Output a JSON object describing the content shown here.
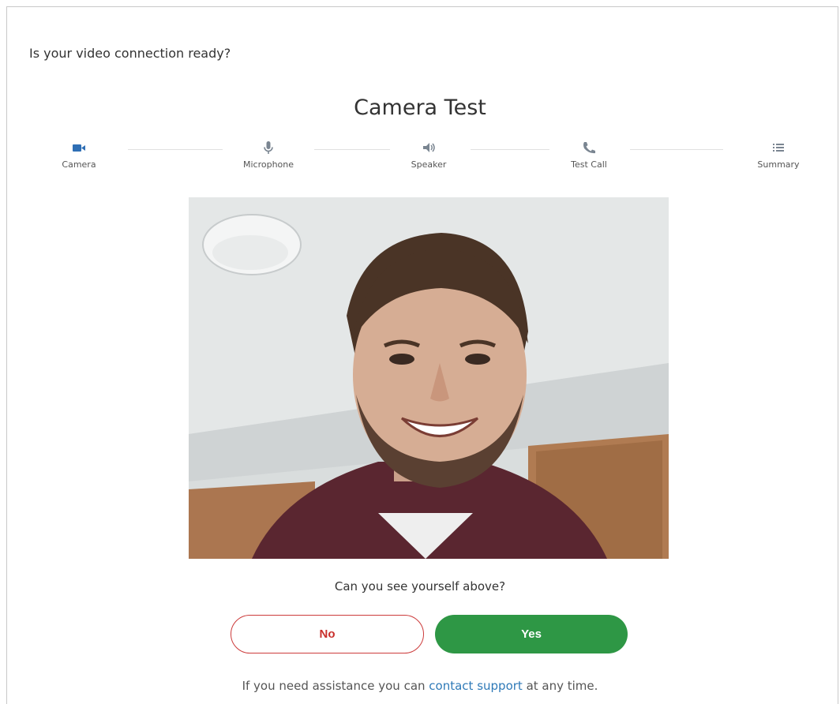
{
  "header": {
    "question": "Is your video connection ready?"
  },
  "page": {
    "title": "Camera Test"
  },
  "steps": [
    {
      "label": "Camera",
      "icon": "camera-icon",
      "active": true
    },
    {
      "label": "Microphone",
      "icon": "microphone-icon",
      "active": false
    },
    {
      "label": "Speaker",
      "icon": "speaker-icon",
      "active": false
    },
    {
      "label": "Test Call",
      "icon": "phone-icon",
      "active": false
    },
    {
      "label": "Summary",
      "icon": "list-icon",
      "active": false
    }
  ],
  "colors": {
    "active_step": "#2f6fb5",
    "inactive_step": "#7a8591",
    "no_button": "#c9302c",
    "yes_button": "#2e9745",
    "link": "#2f7ab8"
  },
  "prompt": "Can you see yourself above?",
  "buttons": {
    "no_label": "No",
    "yes_label": "Yes"
  },
  "assistance": {
    "prefix": "If you need assistance you can ",
    "link_text": "contact support",
    "suffix": " at any time."
  }
}
